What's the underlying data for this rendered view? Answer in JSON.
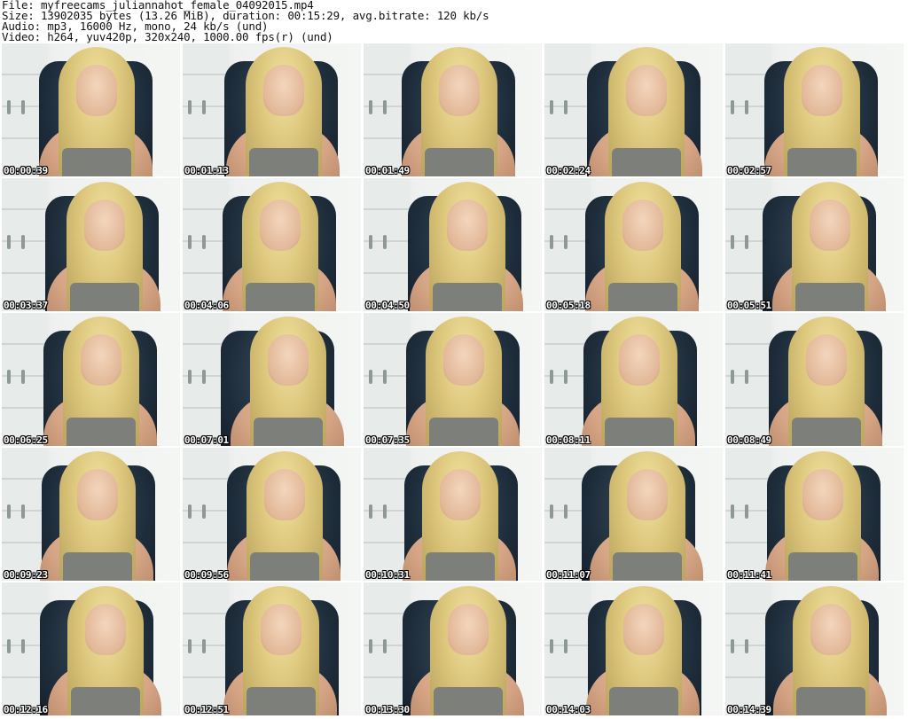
{
  "header": {
    "file": "File: myfreecams_juliannahot_female_04092015.mp4",
    "size": "Size: 13902035 bytes (13.26 MiB), duration: 00:15:29, avg.bitrate: 120 kb/s",
    "audio": "Audio: mp3, 16000 Hz, mono, 24 kb/s (und)",
    "video": "Video: h264, yuv420p, 320x240, 1000.00 fps(r) (und)"
  },
  "thumbnails": [
    {
      "timestamp": "00:00:39"
    },
    {
      "timestamp": "00:01:13"
    },
    {
      "timestamp": "00:01:49"
    },
    {
      "timestamp": "00:02:24"
    },
    {
      "timestamp": "00:02:57"
    },
    {
      "timestamp": "00:03:37"
    },
    {
      "timestamp": "00:04:06"
    },
    {
      "timestamp": "00:04:50"
    },
    {
      "timestamp": "00:05:18"
    },
    {
      "timestamp": "00:05:51"
    },
    {
      "timestamp": "00:06:25"
    },
    {
      "timestamp": "00:07:01"
    },
    {
      "timestamp": "00:07:35"
    },
    {
      "timestamp": "00:08:11"
    },
    {
      "timestamp": "00:08:49"
    },
    {
      "timestamp": "00:09:23"
    },
    {
      "timestamp": "00:09:56"
    },
    {
      "timestamp": "00:10:31"
    },
    {
      "timestamp": "00:11:07"
    },
    {
      "timestamp": "00:11:41"
    },
    {
      "timestamp": "00:12:16"
    },
    {
      "timestamp": "00:12:51"
    },
    {
      "timestamp": "00:13:30"
    },
    {
      "timestamp": "00:14:03"
    },
    {
      "timestamp": "00:14:39"
    }
  ]
}
